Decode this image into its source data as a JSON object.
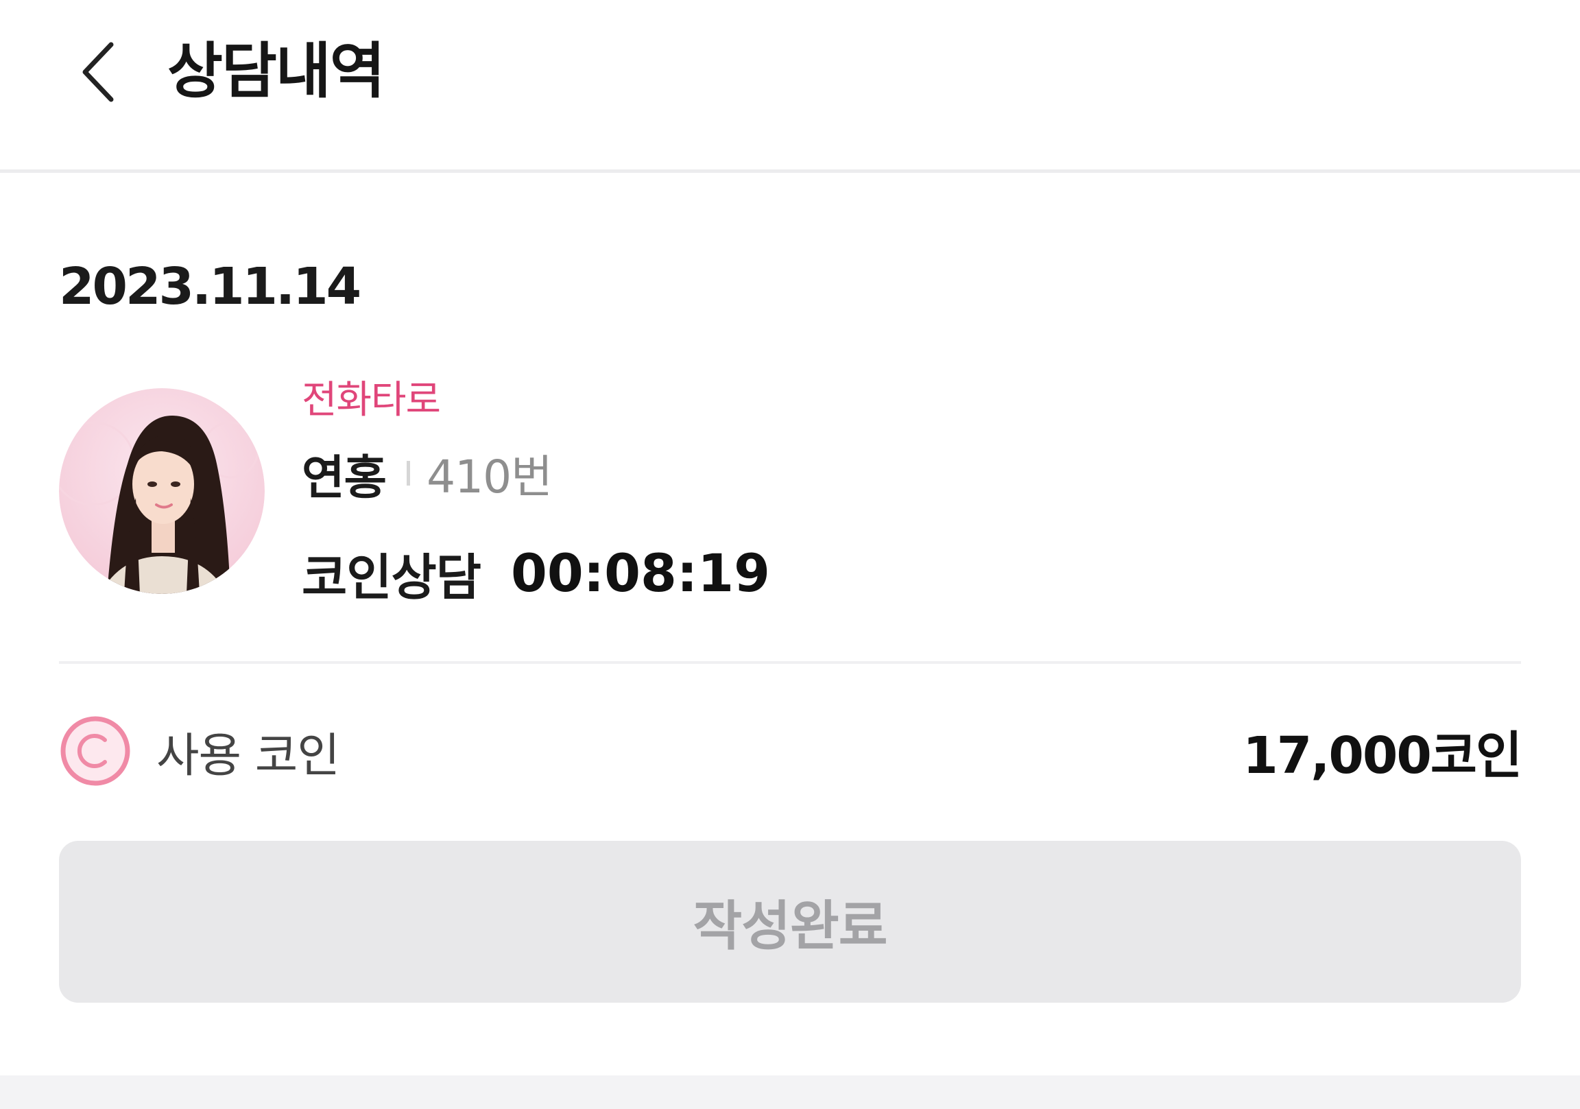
{
  "header": {
    "title": "상담내역"
  },
  "consultation": {
    "date": "2023.11.14",
    "category": "전화타로",
    "counselor_name": "연홍",
    "counselor_number": "410번",
    "consult_type": "코인상담",
    "duration": "00:08:19",
    "coin_label": "사용 코인",
    "coin_amount": "17,000코인"
  },
  "actions": {
    "submit_label": "작성완료"
  },
  "colors": {
    "accent_pink": "#e0467a",
    "coin_icon": "#f08aa6",
    "button_disabled_bg": "#e8e8ea",
    "button_disabled_text": "#a3a3a6"
  },
  "icons": {
    "back": "chevron-left-icon",
    "coin": "coin-c-icon"
  }
}
